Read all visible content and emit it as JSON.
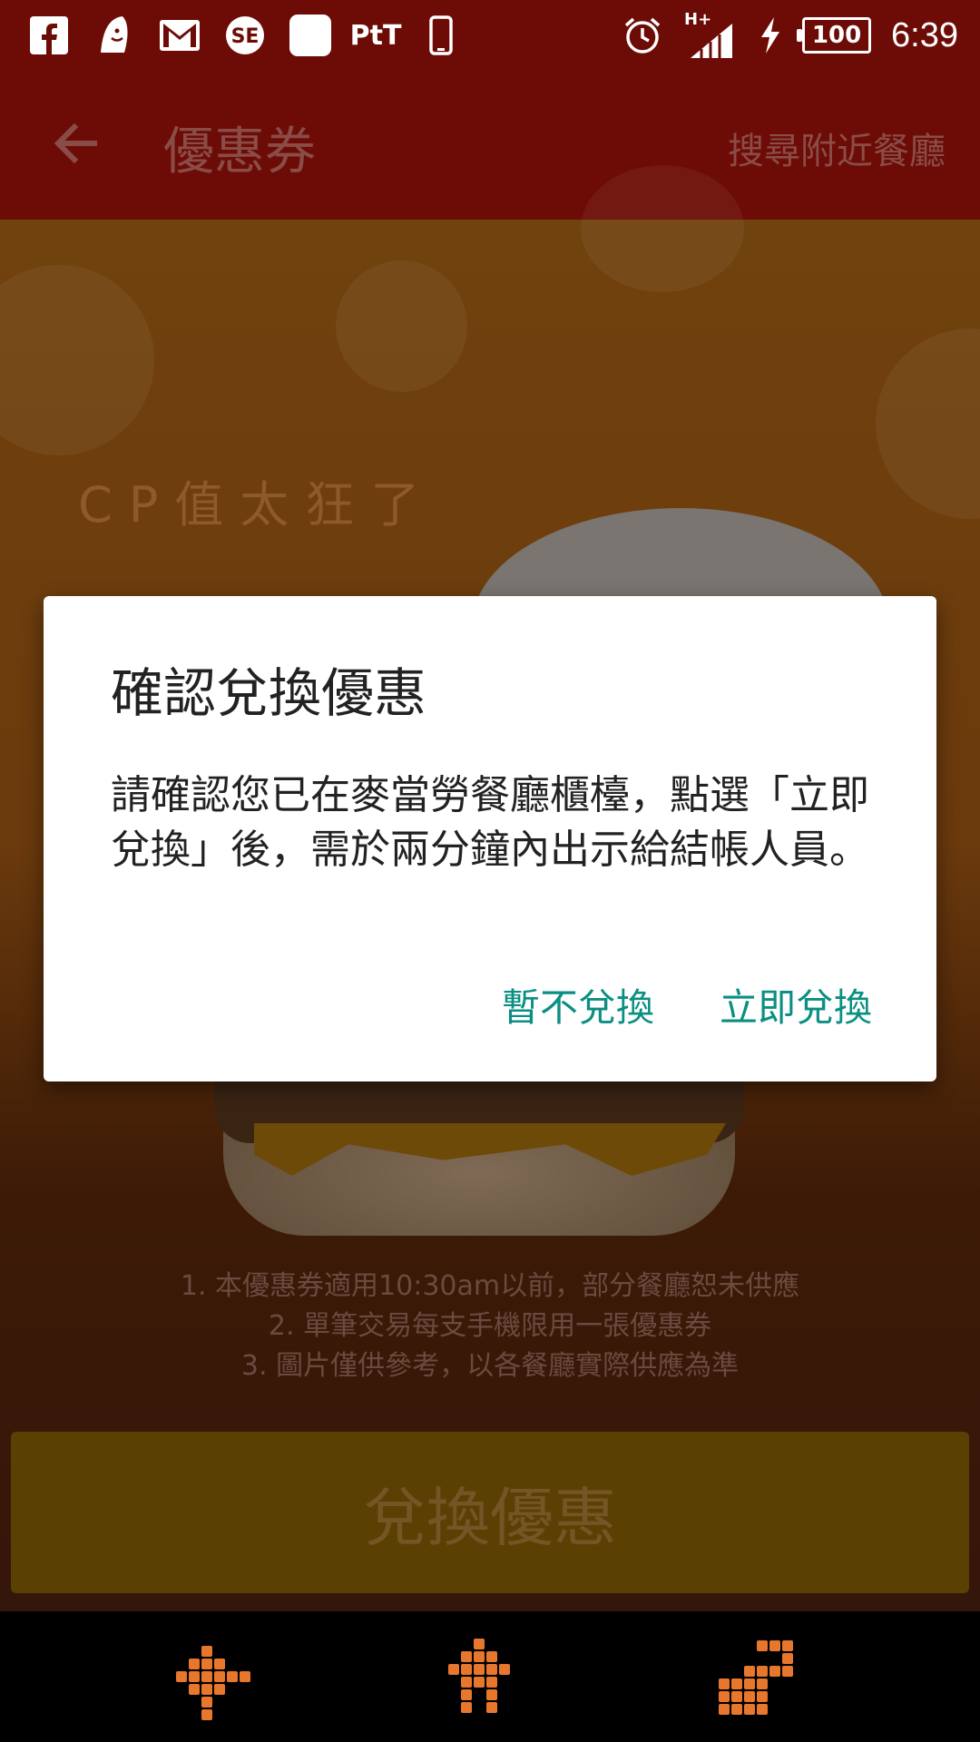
{
  "status_bar": {
    "left_icons": [
      "facebook-icon",
      "ghost-app-icon",
      "gmail-icon",
      "se-app-icon",
      "blank-app-icon",
      "ptt-app-icon",
      "phone-icon"
    ],
    "ptt_label": "PtT",
    "network_label": "H+",
    "battery_level": "100",
    "time": "6:39"
  },
  "app_bar": {
    "title": "優惠券",
    "action": "搜尋附近餐廳"
  },
  "promo": {
    "tagline": "CP值太狂了",
    "notes": [
      "1. 本優惠券適用10:30am以前，部分餐廳恕未供應",
      "2. 單筆交易每支手機限用一張優惠券",
      "3. 圖片僅供參考，以各餐廳實際供應為準"
    ],
    "redeem_label": "兌換優惠"
  },
  "dialog": {
    "title": "確認兌換優惠",
    "message": "請確認您已在麥當勞餐廳櫃檯，點選「立即兌換」後，需於兩分鐘內出示給結帳人員。",
    "cancel_label": "暫不兌換",
    "confirm_label": "立即兌換"
  },
  "colors": {
    "status_bar_bg": "#6d0c06",
    "dialog_button_text": "#0b8f82",
    "nav_icon": "#e8772e"
  }
}
